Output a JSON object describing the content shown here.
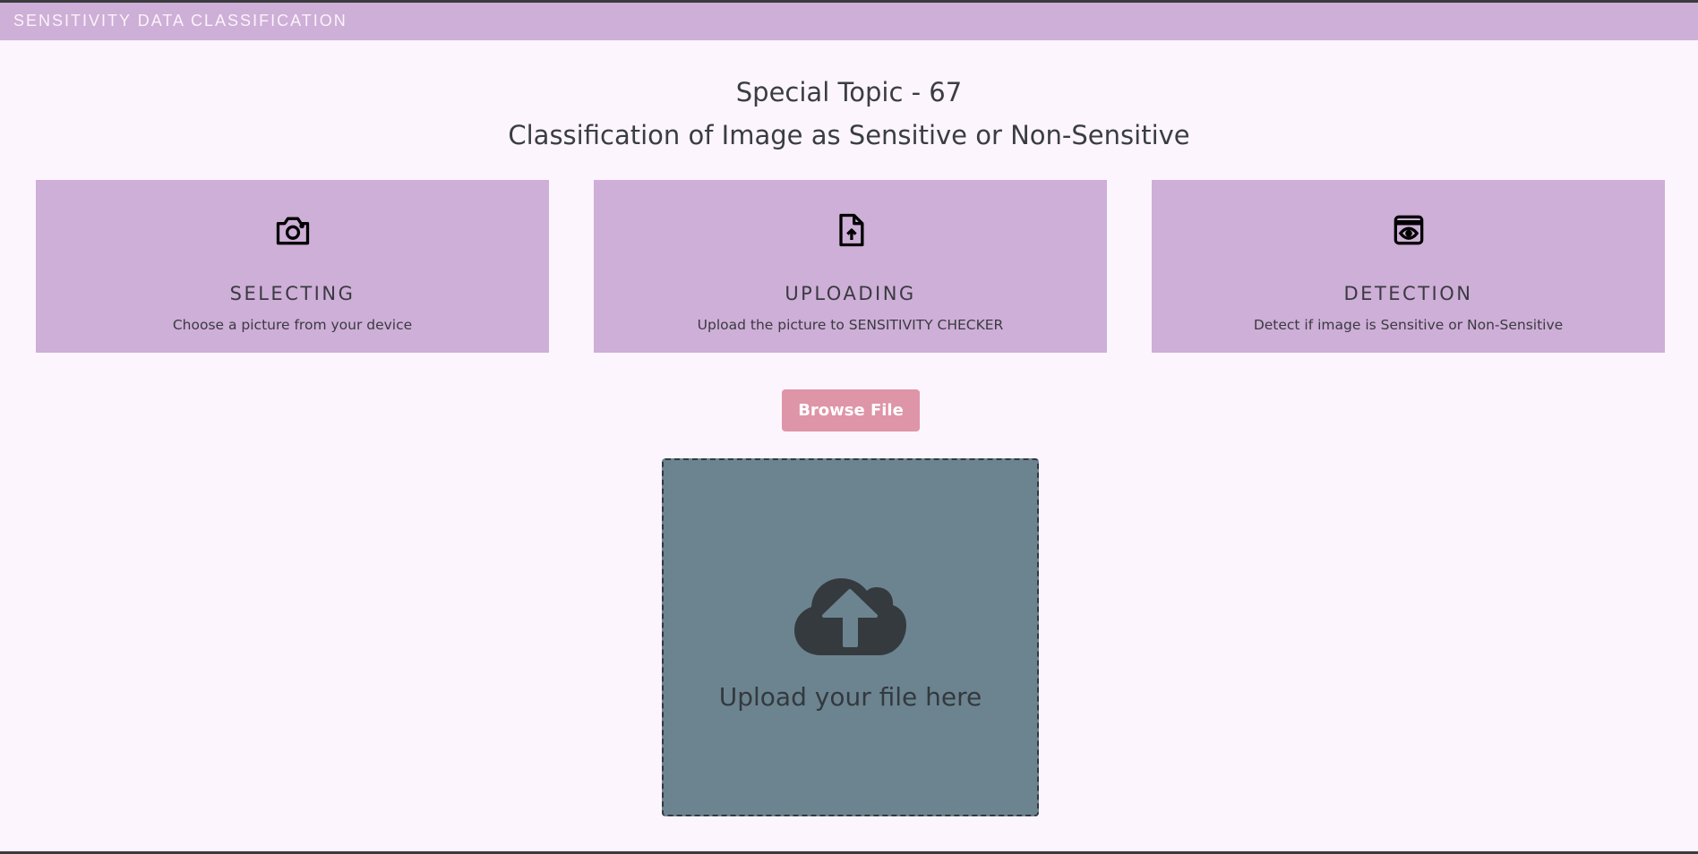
{
  "header": {
    "app_title": "SENSITIVITY DATA CLASSIFICATION"
  },
  "main": {
    "title": "Special Topic - 67",
    "subtitle": "Classification of Image as Sensitive or Non-Sensitive",
    "steps": [
      {
        "icon": "camera-icon",
        "title": "SELECTING",
        "description": "Choose a picture from your device"
      },
      {
        "icon": "file-upload-icon",
        "title": "UPLOADING",
        "description": "Upload the picture to SENSITIVITY CHECKER"
      },
      {
        "icon": "eye-window-icon",
        "title": "DETECTION",
        "description": "Detect if image is Sensitive or Non-Sensitive"
      }
    ],
    "browse_button": "Browse File",
    "dropzone": {
      "icon": "cloud-upload-icon",
      "label": "Upload your file here"
    }
  },
  "colors": {
    "accent": "#ceafd7",
    "button": "#de95a7",
    "dropzone": "#6c8490",
    "background": "#fdf5fe"
  }
}
